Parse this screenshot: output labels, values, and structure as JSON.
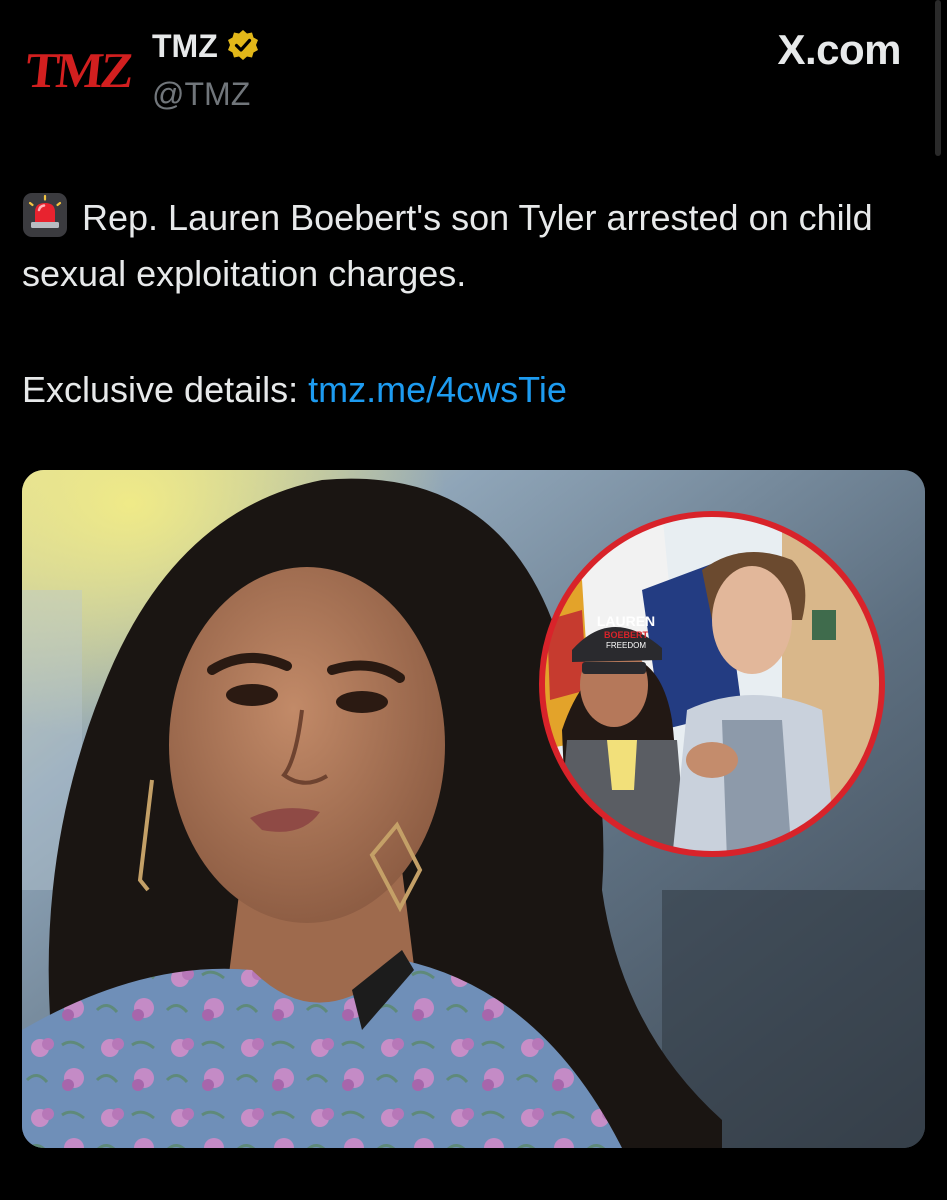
{
  "account": {
    "logo_text": "TMZ",
    "name": "TMZ",
    "handle": "@TMZ",
    "verified": true
  },
  "site": {
    "brand": "X.com"
  },
  "post": {
    "headline": "Rep. Lauren Boebert's son Tyler arrested on child sexual exploitation charges.",
    "details_prefix": "Exclusive details:",
    "details_link": "tmz.me/4cwsTie"
  },
  "media": {
    "cap_text_top": "LAUREN",
    "cap_text_mid": "BOEBERT",
    "cap_text_bottom": "FREEDOM"
  },
  "colors": {
    "background": "#000000",
    "text": "#e7e9ea",
    "muted": "#71767b",
    "link": "#1d9bf0",
    "logo": "#d21f1f",
    "verified": "#e2b719",
    "inset_ring": "#d8232a"
  },
  "icons": {
    "siren": "siren-icon",
    "verified": "verified-badge-icon"
  }
}
